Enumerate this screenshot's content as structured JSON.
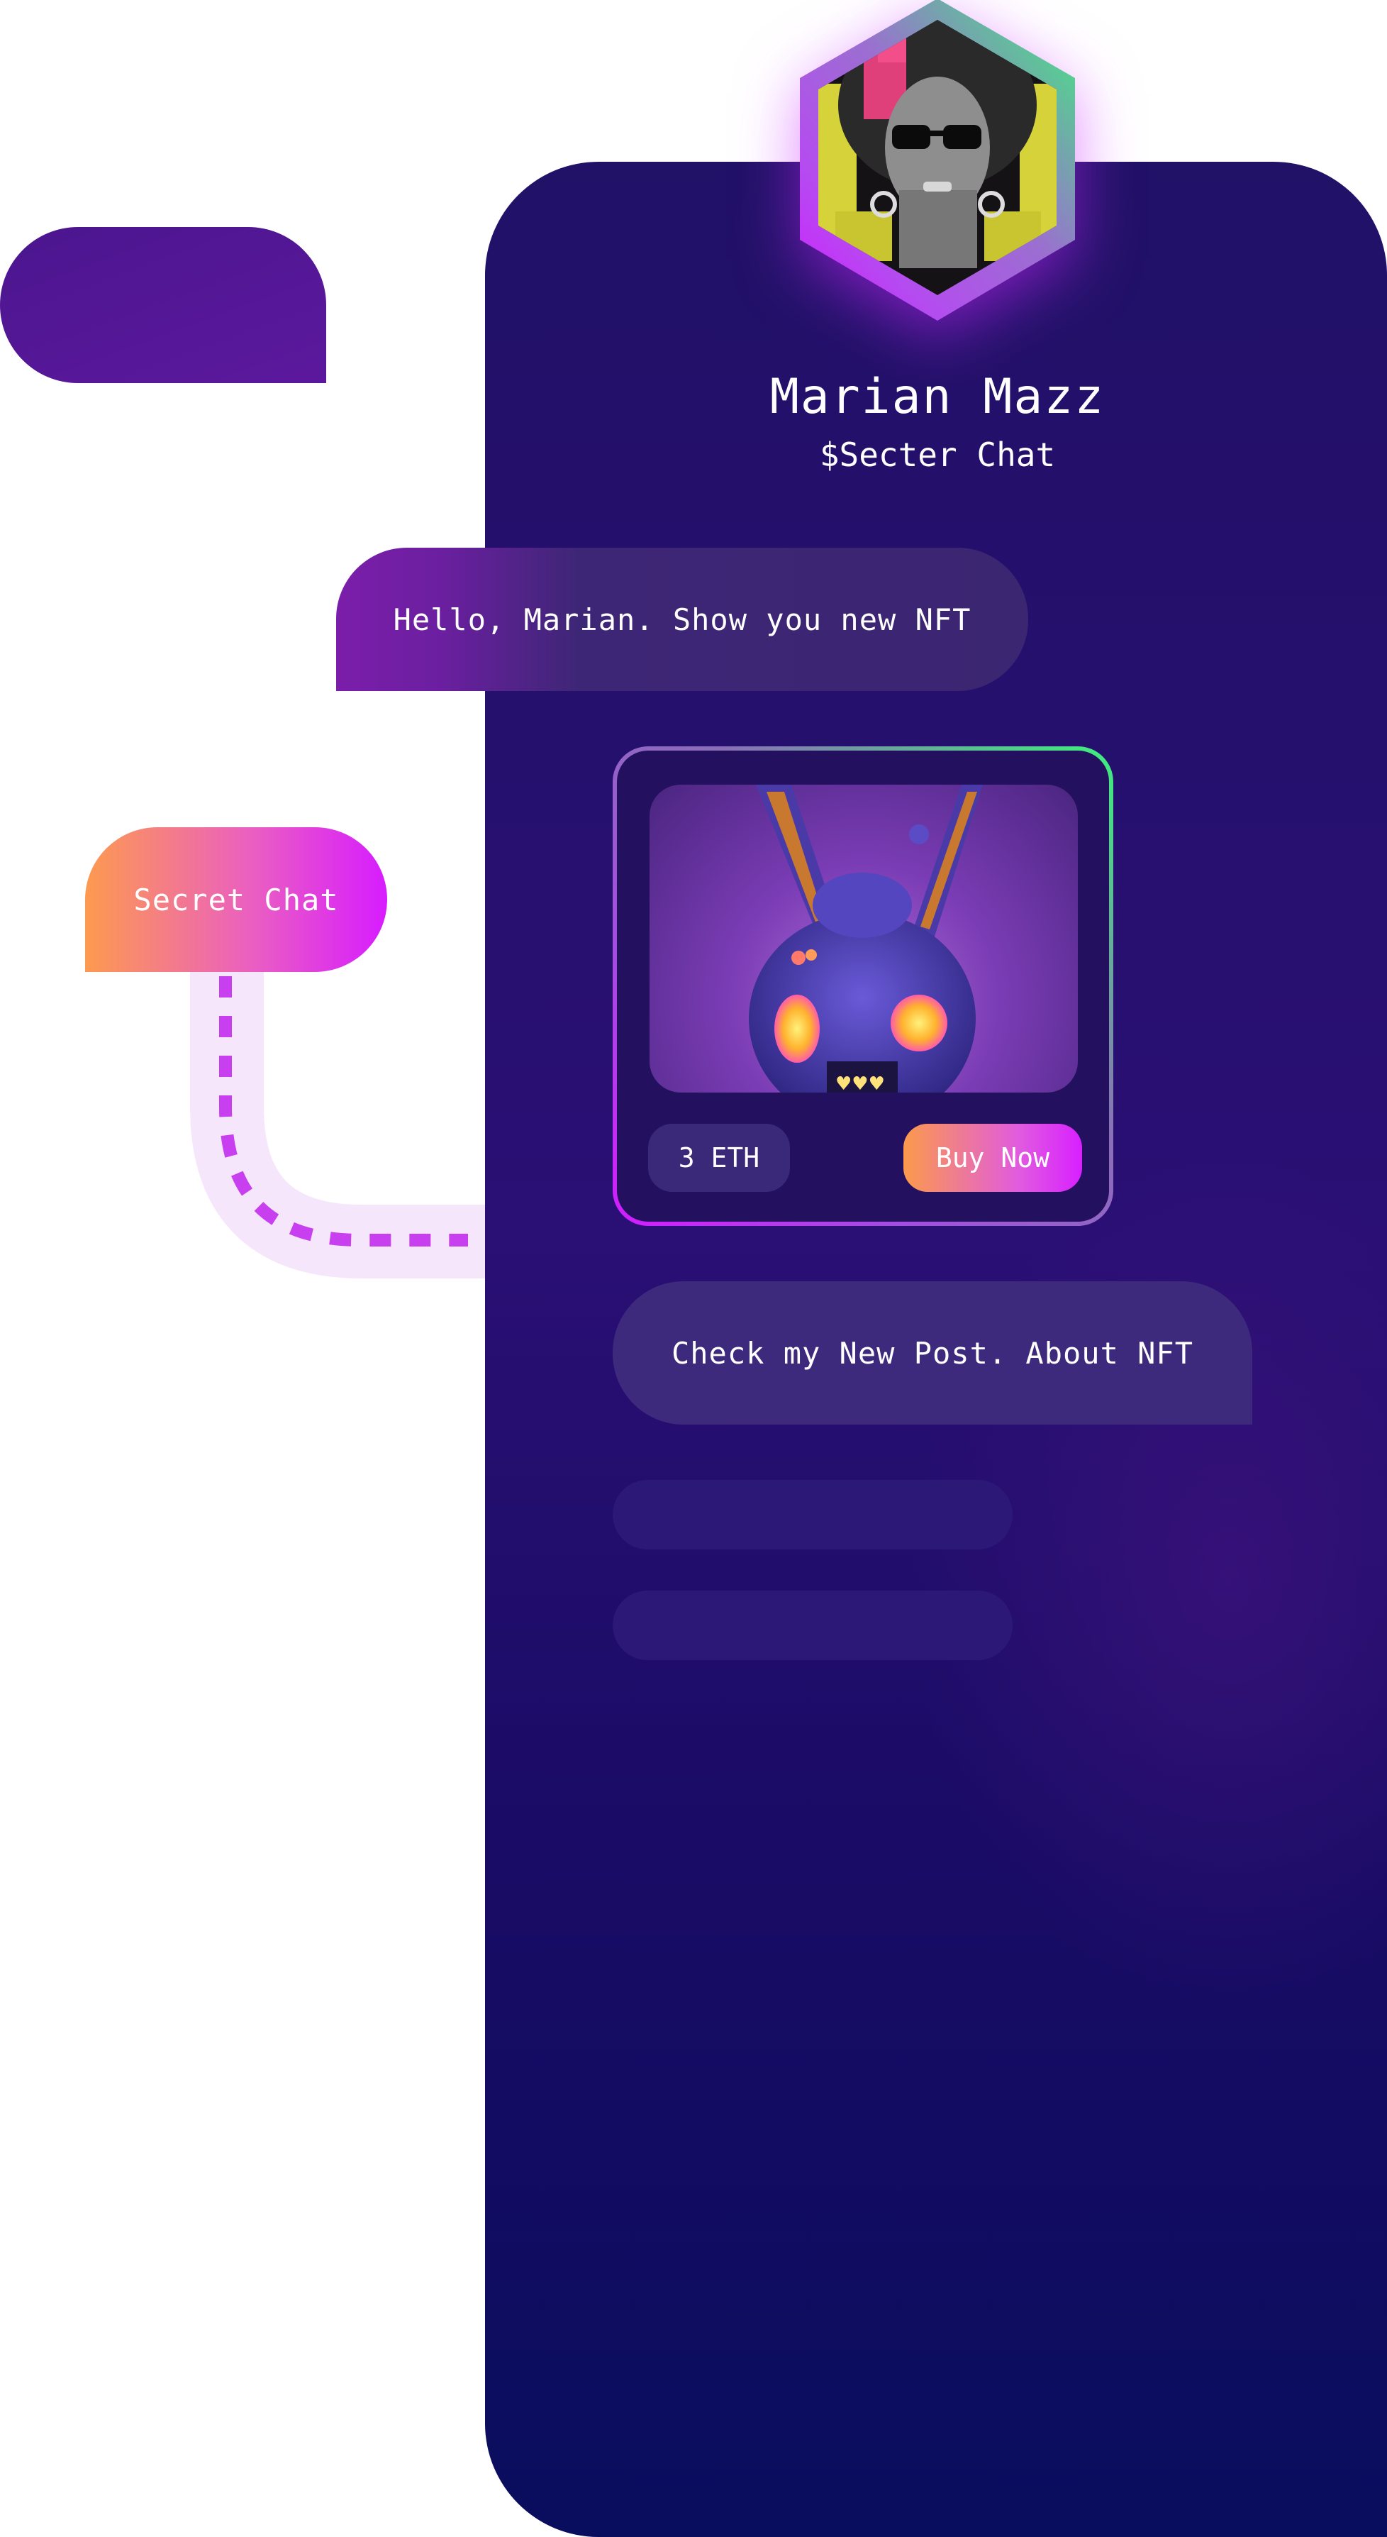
{
  "profile": {
    "name": "Marian Mazz",
    "subtitle": "$Secter Chat",
    "avatar_icon": "profile-avatar-icon"
  },
  "messages": [
    {
      "text": "Hello, Marian. Show you new NFT"
    },
    {
      "text": "Check my New Post. About NFT"
    }
  ],
  "nft": {
    "price": "3 ETH",
    "buy_label": "Buy Now",
    "image_icon": "nft-creature-icon"
  },
  "secret_chat": {
    "label": "Secret Chat"
  },
  "colors": {
    "panel": "#211167",
    "accent_gradient_start": "#fb9a4c",
    "accent_gradient_end": "#d820ff",
    "green_accent": "#3ef07c",
    "bubble": "#3d2a7d"
  }
}
